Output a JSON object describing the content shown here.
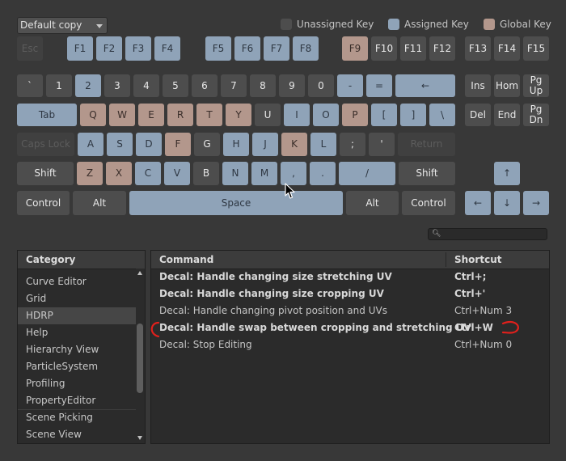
{
  "profile_dropdown": {
    "value": "Default copy"
  },
  "legend": {
    "unassigned": {
      "label": "Unassigned Key",
      "color": "#4d4d4d"
    },
    "assigned": {
      "label": "Assigned Key",
      "color": "#8fa3b8"
    },
    "global": {
      "label": "Global Key",
      "color": "#b3978c"
    }
  },
  "keyboard": {
    "keys": [
      {
        "id": "esc",
        "label": "Esc",
        "state": "disabled"
      },
      {
        "id": "f1",
        "label": "F1",
        "state": "assigned"
      },
      {
        "id": "f2",
        "label": "F2",
        "state": "assigned"
      },
      {
        "id": "f3",
        "label": "F3",
        "state": "assigned"
      },
      {
        "id": "f4",
        "label": "F4",
        "state": "assigned"
      },
      {
        "id": "f5",
        "label": "F5",
        "state": "assigned"
      },
      {
        "id": "f6",
        "label": "F6",
        "state": "assigned"
      },
      {
        "id": "f7",
        "label": "F7",
        "state": "assigned"
      },
      {
        "id": "f8",
        "label": "F8",
        "state": "assigned"
      },
      {
        "id": "f9",
        "label": "F9",
        "state": "global"
      },
      {
        "id": "f10",
        "label": "F10",
        "state": "unassigned"
      },
      {
        "id": "f11",
        "label": "F11",
        "state": "unassigned"
      },
      {
        "id": "f12",
        "label": "F12",
        "state": "unassigned"
      },
      {
        "id": "f13",
        "label": "F13",
        "state": "unassigned"
      },
      {
        "id": "f14",
        "label": "F14",
        "state": "unassigned"
      },
      {
        "id": "f15",
        "label": "F15",
        "state": "unassigned"
      },
      {
        "id": "backquote",
        "label": "`",
        "state": "unassigned"
      },
      {
        "id": "1",
        "label": "1",
        "state": "unassigned"
      },
      {
        "id": "2",
        "label": "2",
        "state": "assigned"
      },
      {
        "id": "3",
        "label": "3",
        "state": "unassigned"
      },
      {
        "id": "4",
        "label": "4",
        "state": "unassigned"
      },
      {
        "id": "5",
        "label": "5",
        "state": "unassigned"
      },
      {
        "id": "6",
        "label": "6",
        "state": "unassigned"
      },
      {
        "id": "7",
        "label": "7",
        "state": "unassigned"
      },
      {
        "id": "8",
        "label": "8",
        "state": "unassigned"
      },
      {
        "id": "9",
        "label": "9",
        "state": "unassigned"
      },
      {
        "id": "0",
        "label": "0",
        "state": "unassigned"
      },
      {
        "id": "minus",
        "label": "-",
        "state": "assigned"
      },
      {
        "id": "equals",
        "label": "=",
        "state": "assigned"
      },
      {
        "id": "backspace",
        "label": "←",
        "state": "assigned"
      },
      {
        "id": "ins",
        "label": "Ins",
        "state": "unassigned"
      },
      {
        "id": "home",
        "label": "Hom",
        "state": "unassigned"
      },
      {
        "id": "pgup",
        "label": "Pg\nUp",
        "state": "unassigned"
      },
      {
        "id": "tab",
        "label": "Tab",
        "state": "assigned"
      },
      {
        "id": "q",
        "label": "Q",
        "state": "global"
      },
      {
        "id": "w",
        "label": "W",
        "state": "global"
      },
      {
        "id": "e",
        "label": "E",
        "state": "global"
      },
      {
        "id": "r",
        "label": "R",
        "state": "global"
      },
      {
        "id": "t",
        "label": "T",
        "state": "global"
      },
      {
        "id": "y",
        "label": "Y",
        "state": "global"
      },
      {
        "id": "u",
        "label": "U",
        "state": "unassigned"
      },
      {
        "id": "i",
        "label": "I",
        "state": "assigned"
      },
      {
        "id": "o",
        "label": "O",
        "state": "assigned"
      },
      {
        "id": "p",
        "label": "P",
        "state": "global"
      },
      {
        "id": "lbracket",
        "label": "[",
        "state": "assigned"
      },
      {
        "id": "rbracket",
        "label": "]",
        "state": "assigned"
      },
      {
        "id": "backslash",
        "label": "\\",
        "state": "assigned"
      },
      {
        "id": "del",
        "label": "Del",
        "state": "unassigned"
      },
      {
        "id": "end",
        "label": "End",
        "state": "unassigned"
      },
      {
        "id": "pgdn",
        "label": "Pg\nDn",
        "state": "unassigned"
      },
      {
        "id": "capslock",
        "label": "Caps Lock",
        "state": "disabled"
      },
      {
        "id": "a",
        "label": "A",
        "state": "assigned"
      },
      {
        "id": "s",
        "label": "S",
        "state": "assigned"
      },
      {
        "id": "d",
        "label": "D",
        "state": "assigned"
      },
      {
        "id": "f",
        "label": "F",
        "state": "global"
      },
      {
        "id": "g",
        "label": "G",
        "state": "unassigned"
      },
      {
        "id": "h",
        "label": "H",
        "state": "assigned"
      },
      {
        "id": "j",
        "label": "J",
        "state": "assigned"
      },
      {
        "id": "k",
        "label": "K",
        "state": "global"
      },
      {
        "id": "l",
        "label": "L",
        "state": "assigned"
      },
      {
        "id": "semicolon",
        "label": ";",
        "state": "unassigned"
      },
      {
        "id": "quote",
        "label": "'",
        "state": "unassigned"
      },
      {
        "id": "return",
        "label": "Return",
        "state": "disabled"
      },
      {
        "id": "lshift",
        "label": "Shift",
        "state": "unassigned"
      },
      {
        "id": "z",
        "label": "Z",
        "state": "global"
      },
      {
        "id": "x",
        "label": "X",
        "state": "global"
      },
      {
        "id": "c",
        "label": "C",
        "state": "assigned"
      },
      {
        "id": "v",
        "label": "V",
        "state": "assigned"
      },
      {
        "id": "b",
        "label": "B",
        "state": "unassigned"
      },
      {
        "id": "n",
        "label": "N",
        "state": "assigned"
      },
      {
        "id": "m",
        "label": "M",
        "state": "assigned"
      },
      {
        "id": "comma",
        "label": ",",
        "state": "assigned"
      },
      {
        "id": "period",
        "label": ".",
        "state": "assigned"
      },
      {
        "id": "slash",
        "label": "/",
        "state": "assigned"
      },
      {
        "id": "rshift",
        "label": "Shift",
        "state": "unassigned"
      },
      {
        "id": "uparrow",
        "label": "↑",
        "state": "assigned"
      },
      {
        "id": "lcontrol",
        "label": "Control",
        "state": "unassigned"
      },
      {
        "id": "lalt",
        "label": "Alt",
        "state": "unassigned"
      },
      {
        "id": "space",
        "label": "Space",
        "state": "assigned"
      },
      {
        "id": "ralt",
        "label": "Alt",
        "state": "unassigned"
      },
      {
        "id": "rcontrol",
        "label": "Control",
        "state": "unassigned"
      },
      {
        "id": "leftarrow",
        "label": "←",
        "state": "assigned"
      },
      {
        "id": "downarrow",
        "label": "↓",
        "state": "assigned"
      },
      {
        "id": "rightarrow",
        "label": "→",
        "state": "assigned"
      }
    ]
  },
  "search": {
    "icon": "search-icon",
    "value": ""
  },
  "category": {
    "header": "Category",
    "items": [
      {
        "label": "Curve Editor",
        "selected": false
      },
      {
        "label": "Grid",
        "selected": false
      },
      {
        "label": "HDRP",
        "selected": true
      },
      {
        "label": "Help",
        "selected": false
      },
      {
        "label": "Hierarchy View",
        "selected": false
      },
      {
        "label": "ParticleSystem",
        "selected": false
      },
      {
        "label": "Profiling",
        "selected": false
      },
      {
        "label": "PropertyEditor",
        "selected": false
      },
      {
        "label": "Scene Picking",
        "selected": false
      },
      {
        "label": "Scene View",
        "selected": false
      }
    ]
  },
  "commands": {
    "header_command": "Command",
    "header_shortcut": "Shortcut",
    "rows": [
      {
        "command": "Decal: Handle changing size stretching UV",
        "shortcut": "Ctrl+;",
        "bold": true
      },
      {
        "command": "Decal: Handle changing size cropping UV",
        "shortcut": "Ctrl+'",
        "bold": true
      },
      {
        "command": "Decal: Handle changing pivot position and UVs",
        "shortcut": "Ctrl+Num 3",
        "bold": false
      },
      {
        "command": "Decal: Handle swap between cropping and stretching UV",
        "shortcut": "Ctrl+W",
        "bold": true
      },
      {
        "command": "Decal: Stop Editing",
        "shortcut": "Ctrl+Num 0",
        "bold": false
      }
    ]
  },
  "annotation_color": "#e0201c"
}
